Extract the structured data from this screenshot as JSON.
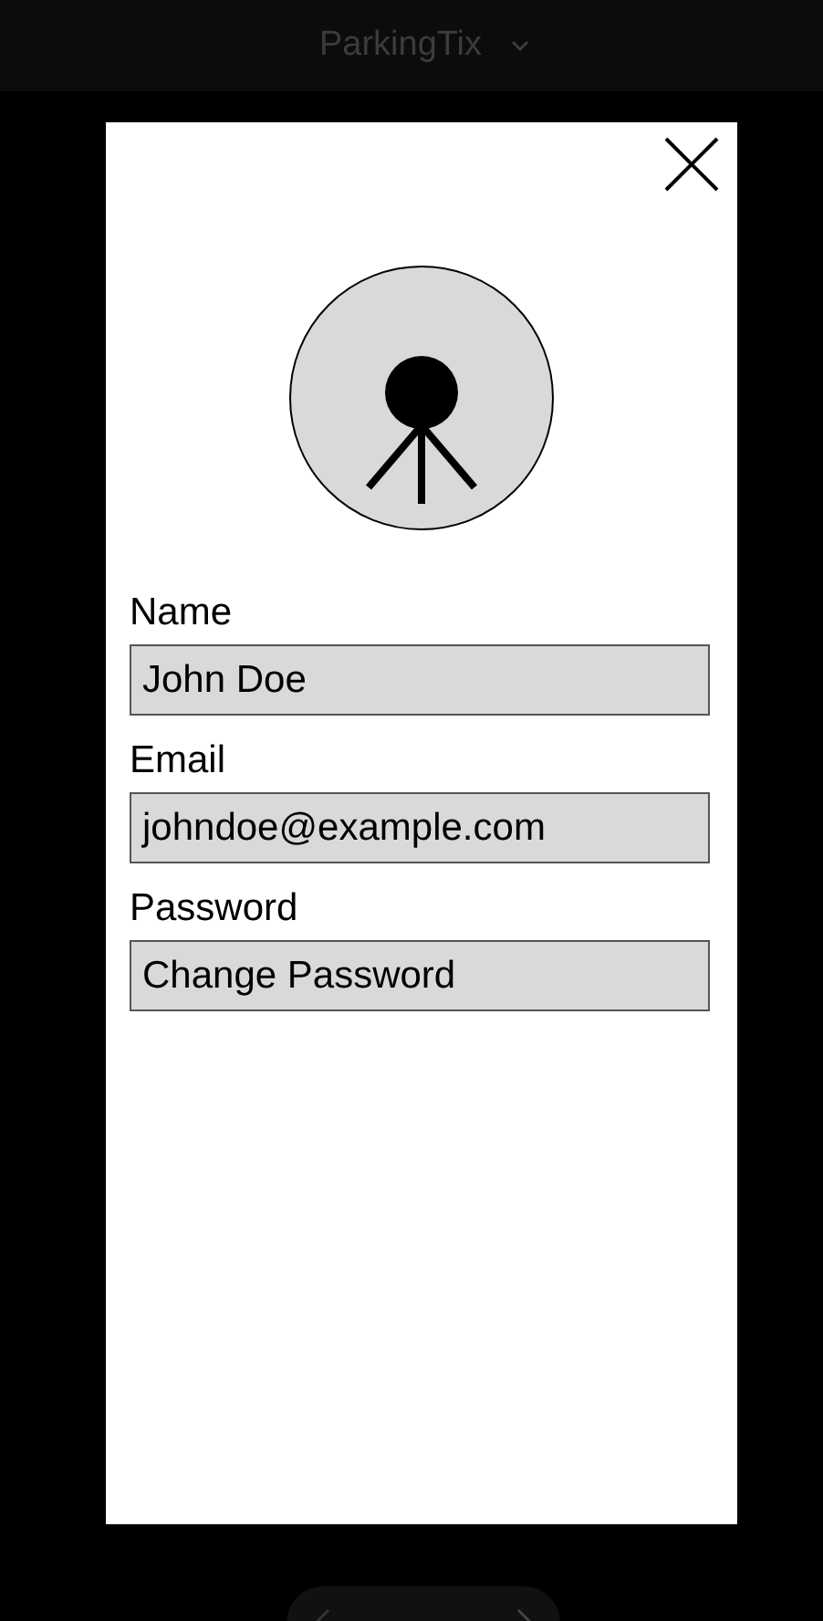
{
  "app_bar": {
    "title": "ParkingTix"
  },
  "fields": [
    {
      "label": "Name",
      "value": "John Doe"
    },
    {
      "label": "Email",
      "value": "johndoe@example.com"
    },
    {
      "label": "Password",
      "value": "Change Password"
    }
  ]
}
